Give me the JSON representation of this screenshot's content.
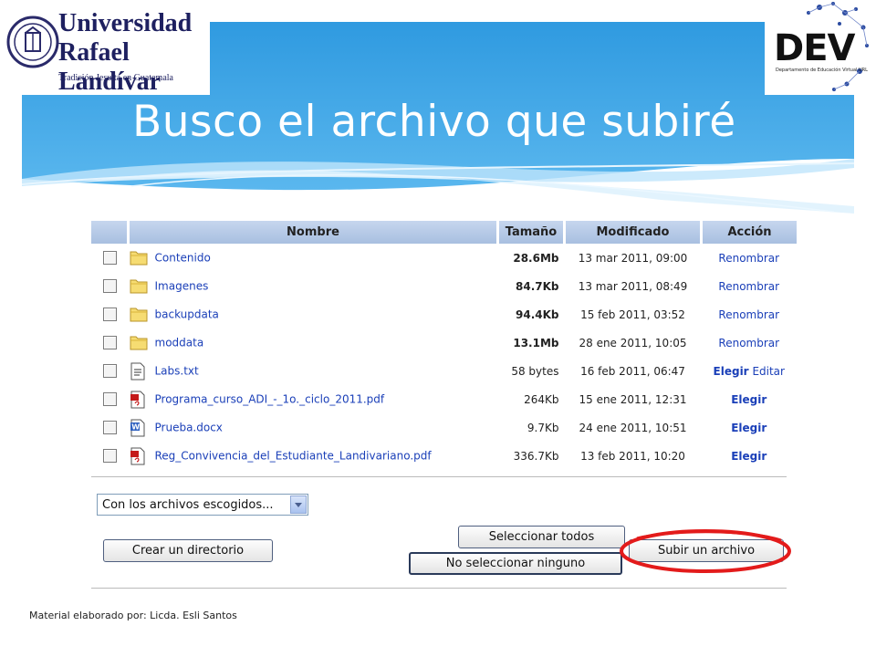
{
  "header": {
    "university_name_line1": "Universidad",
    "university_name_line2": "Rafael Landívar",
    "university_tagline": "Tradición Jesuita en Guatemala",
    "dev_logo_text": "DEV",
    "dev_logo_subtitle": "Departamento de Educación Virtual URL",
    "slide_title": "Busco el archivo que subiré"
  },
  "table": {
    "columns": [
      "Nombre",
      "Tamaño",
      "Modificado",
      "Acción"
    ],
    "rows": [
      {
        "name": "Contenido",
        "icon": "folder-icon",
        "size": "28.6Mb",
        "size_bold": true,
        "modified": "13 mar 2011, 09:00",
        "actions": [
          "Renombrar"
        ]
      },
      {
        "name": "Imagenes",
        "icon": "folder-icon",
        "size": "84.7Kb",
        "size_bold": true,
        "modified": "13 mar 2011, 08:49",
        "actions": [
          "Renombrar"
        ]
      },
      {
        "name": "backupdata",
        "icon": "folder-icon",
        "size": "94.4Kb",
        "size_bold": true,
        "modified": "15 feb 2011, 03:52",
        "actions": [
          "Renombrar"
        ]
      },
      {
        "name": "moddata",
        "icon": "folder-icon",
        "size": "13.1Mb",
        "size_bold": true,
        "modified": "28 ene 2011, 10:05",
        "actions": [
          "Renombrar"
        ]
      },
      {
        "name": "Labs.txt",
        "icon": "text-file-icon",
        "size": "58 bytes",
        "size_bold": false,
        "modified": "16 feb 2011, 06:47",
        "actions": [
          "Elegir",
          "Editar"
        ]
      },
      {
        "name": "Programa_curso_ADI_-_1o._ciclo_2011.pdf",
        "icon": "pdf-file-icon",
        "size": "264Kb",
        "size_bold": false,
        "modified": "15 ene 2011, 12:31",
        "actions": [
          "Elegir"
        ]
      },
      {
        "name": "Prueba.docx",
        "icon": "word-file-icon",
        "size": "9.7Kb",
        "size_bold": false,
        "modified": "24 ene 2011, 10:51",
        "actions": [
          "Elegir"
        ]
      },
      {
        "name": "Reg_Convivencia_del_Estudiante_Landivariano.pdf",
        "icon": "pdf-file-icon",
        "size": "336.7Kb",
        "size_bold": false,
        "modified": "13 feb 2011, 10:20",
        "actions": [
          "Elegir"
        ]
      }
    ]
  },
  "controls": {
    "bulk_action_select": "Con los archivos escogidos...",
    "create_dir_button": "Crear un directorio",
    "select_all_button": "Seleccionar todos",
    "select_none_button": "No seleccionar ninguno",
    "upload_button": "Subir un archivo"
  },
  "footer": {
    "credit": "Material elaborado por: Licda. Esli Santos"
  },
  "colors": {
    "banner_blue": "#3aa3e3",
    "link_blue": "#1a3fb8",
    "highlight_red": "#e31b1b",
    "header_blue": "#b6c9e7"
  }
}
